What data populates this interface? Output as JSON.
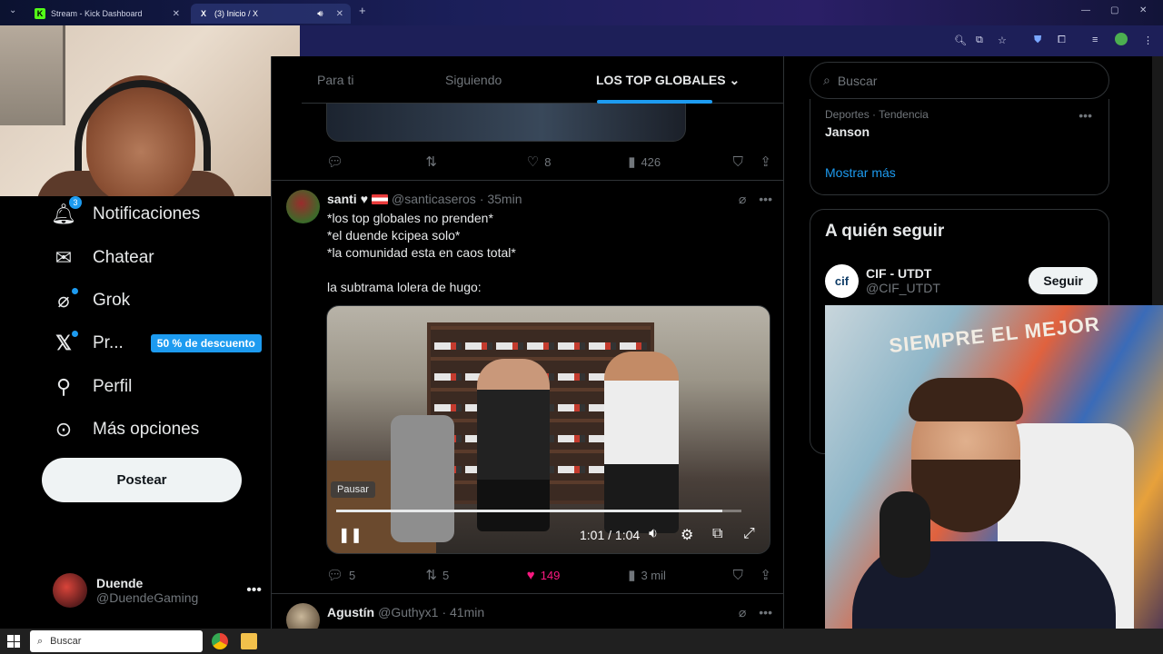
{
  "browser": {
    "tabs": [
      {
        "title": "Stream - Kick Dashboard",
        "favicon": "K"
      },
      {
        "title": "(3) Inicio / X",
        "favicon": "X"
      }
    ]
  },
  "nav": {
    "items": [
      {
        "label": "Notificaciones",
        "icon": "bell-icon",
        "badge": "3"
      },
      {
        "label": "Chatear",
        "icon": "mail-icon"
      },
      {
        "label": "Grok",
        "icon": "grok-icon"
      },
      {
        "label": "Pr...",
        "icon": "x-logo-icon",
        "promo": "50 % de descuento"
      },
      {
        "label": "Perfil",
        "icon": "person-icon"
      },
      {
        "label": "Más opciones",
        "icon": "more-circle-icon"
      }
    ],
    "post_button": "Postear",
    "account": {
      "display_name": "Duende",
      "handle": "@DuendeGaming"
    }
  },
  "timeline": {
    "tabs": [
      "Para ti",
      "Siguiendo",
      "LOS TOP GLOBALES"
    ],
    "prev_actions": {
      "likes": "8",
      "views": "426"
    },
    "tweet1": {
      "name": "santi",
      "handle": "@santicaseros",
      "time": "· 35min",
      "lines": [
        "*los top globales no prenden*",
        "*el duende kcipea solo*",
        "*la comunidad esta en caos total*",
        "",
        "la subtrama lolera de hugo:"
      ],
      "video": {
        "tooltip": "Pausar",
        "time": "1:01 / 1:04",
        "progress": 0.953
      },
      "actions": {
        "replies": "5",
        "retweets": "5",
        "likes": "149",
        "views": "3 mil"
      }
    },
    "tweet2": {
      "name": "Agustín",
      "handle": "@Guthyx1",
      "time": "· 41min"
    }
  },
  "sidebar": {
    "search_placeholder": "Buscar",
    "trend": {
      "category": "Deportes · Tendencia",
      "name": "Janson",
      "show_more": "Mostrar más"
    },
    "who_to_follow": {
      "title": "A quién seguir",
      "user": {
        "logo": "cif",
        "display_name": "CIF - UTDT",
        "handle": "@CIF_UTDT",
        "button": "Seguir"
      }
    }
  },
  "webcam_overlay": {
    "wall_text": "SIEMPRE EL MEJOR"
  },
  "taskbar": {
    "search_placeholder": "Buscar"
  },
  "colors": {
    "accent": "#1d9bf0",
    "like": "#f91880",
    "bg": "#000000",
    "border": "#2f3336"
  }
}
